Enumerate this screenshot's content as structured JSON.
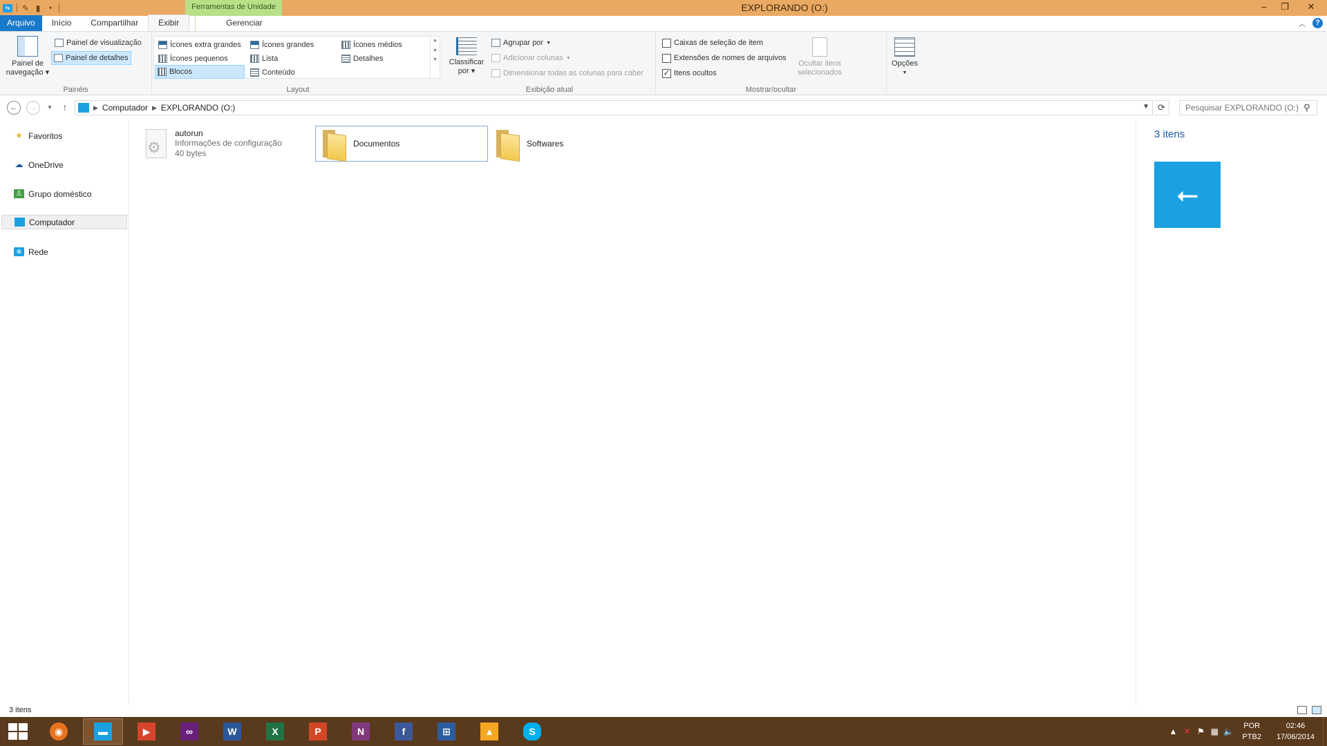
{
  "titlebar": {
    "context_tab": "Ferramentas de Unidade",
    "title": "EXPLORANDO (O:)"
  },
  "tabs": {
    "file": "Arquivo",
    "home": "Início",
    "share": "Compartilhar",
    "view": "Exibir",
    "manage": "Gerenciar"
  },
  "ribbon": {
    "panes": {
      "nav_pane": "Painel de navegação",
      "preview_pane": "Painel de visualização",
      "details_pane": "Painel de detalhes",
      "label": "Painéis"
    },
    "layout": {
      "extra_large": "Ícones extra grandes",
      "large": "Ícones grandes",
      "medium": "Ícones médios",
      "small": "Ícones pequenos",
      "list": "Lista",
      "details": "Detalhes",
      "tiles": "Blocos",
      "content": "Conteúdo",
      "label": "Layout"
    },
    "current_view": {
      "sort_by": "Classificar por",
      "group_by": "Agrupar por",
      "add_columns": "Adicionar colunas",
      "size_columns": "Dimensionar todas as colunas para caber",
      "label": "Exibição atual"
    },
    "show_hide": {
      "item_checkboxes": "Caixas de seleção de item",
      "file_extensions": "Extensões de nomes de arquivos",
      "hidden_items": "Itens ocultos",
      "hide_selected": "Ocultar itens selecionados",
      "label": "Mostrar/ocultar"
    },
    "options": "Opções"
  },
  "address": {
    "crumbs": [
      "Computador",
      "EXPLORANDO (O:)"
    ],
    "search_placeholder": "Pesquisar EXPLORANDO (O:)"
  },
  "navpane": {
    "items": [
      "Favoritos",
      "OneDrive",
      "Grupo doméstico",
      "Computador",
      "Rede"
    ]
  },
  "content": {
    "autorun": {
      "name": "autorun",
      "type": "Informações de configuração",
      "size": "40 bytes"
    },
    "folders": [
      "Documentos",
      "Softwares"
    ]
  },
  "details": {
    "count": "3 itens"
  },
  "status": {
    "count": "3 itens"
  },
  "tray": {
    "lang1": "POR",
    "lang2": "PTB2",
    "time": "02:46",
    "date": "17/06/2014"
  },
  "colors": {
    "titlebar": "#eaa962",
    "file_tab": "#1979ca",
    "taskbar": "#5a3a1c",
    "usb_tile": "#1ba1e2"
  }
}
